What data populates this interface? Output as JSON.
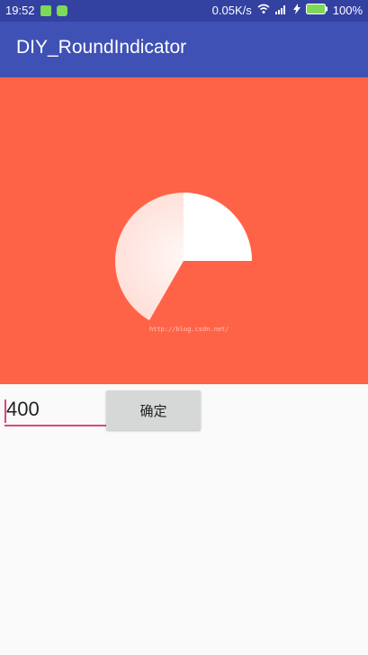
{
  "status_bar": {
    "time": "19:52",
    "network_speed": "0.05K/s",
    "battery": "100%"
  },
  "app_bar": {
    "title": "DIY_RoundIndicator"
  },
  "indicator": {
    "panel_color": "#ff6347",
    "watermark": "http://blog.csdn.net/"
  },
  "form": {
    "input_value": "400",
    "confirm_label": "确定"
  }
}
